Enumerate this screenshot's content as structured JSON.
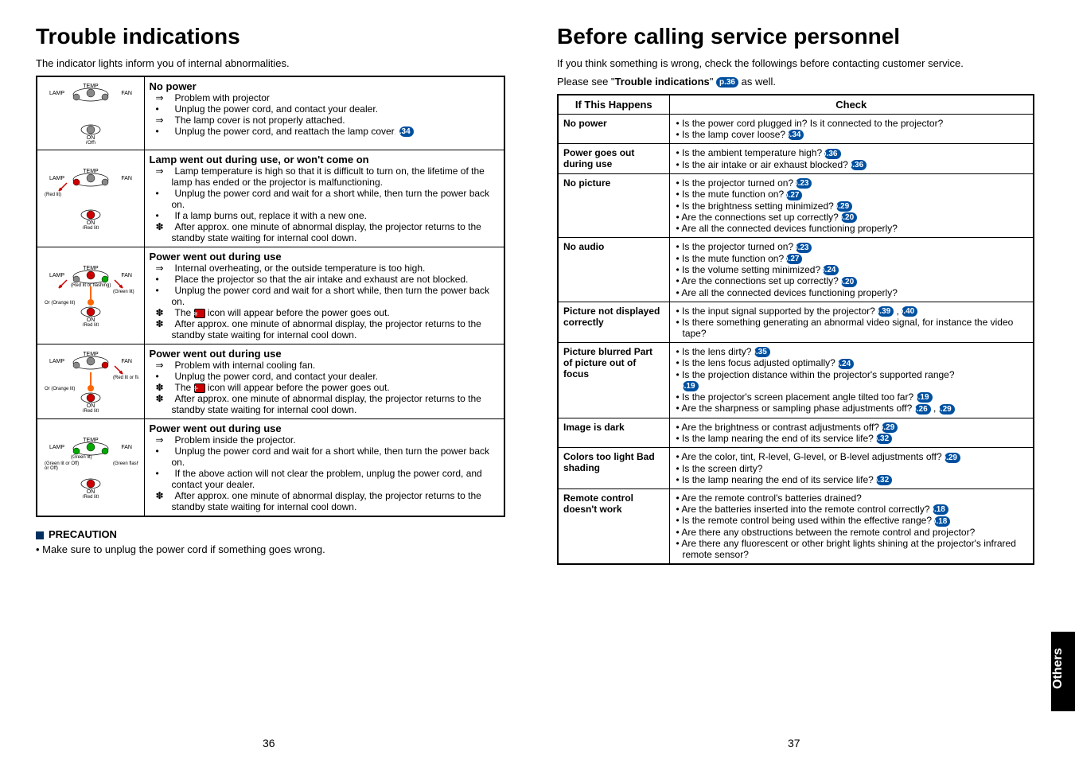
{
  "left": {
    "heading": "Trouble indications",
    "intro": "The indicator lights inform you of internal abnormalities.",
    "rows": [
      {
        "svg_labels": {
          "temp": "TEMP",
          "lamp": "LAMP",
          "fan": "FAN",
          "on": "ON",
          "sub": "(Off)"
        },
        "svg_colors": {
          "temp": "#888",
          "lamp": "#888",
          "fan": "#888",
          "on": "#888",
          "arrows": false
        },
        "title": "No power",
        "lines": [
          {
            "prefix": "⇒",
            "text": "Problem with projector"
          },
          {
            "prefix": "•",
            "text": "Unplug the power cord, and contact your dealer."
          },
          {
            "prefix": "⇒",
            "text": "The lamp cover is not properly attached."
          },
          {
            "prefix": "•",
            "text": "Unplug the power cord, and reattach the lamp cover.",
            "pref": "p.34"
          }
        ]
      },
      {
        "svg_labels": {
          "temp": "TEMP",
          "lamp": "LAMP",
          "fan": "FAN",
          "on": "ON",
          "sub": "(Red lit)",
          "lampnote": "(Red lit)"
        },
        "svg_colors": {
          "lamp": "#c00",
          "on": "#c00",
          "arrows": "lamp"
        },
        "title": "Lamp went out during use, or won't come on",
        "lines": [
          {
            "prefix": "⇒",
            "text": "Lamp temperature is high so that it is difficult to turn on, the lifetime of the lamp has ended or the projector is malfunctioning."
          },
          {
            "prefix": "•",
            "text": "Unplug the power cord and wait for a short while, then turn the power back on."
          },
          {
            "prefix": "•",
            "text": "If a lamp burns out, replace it with a new one."
          },
          {
            "prefix": "✽",
            "text": "After approx. one minute of abnormal display, the projector returns to the standby state waiting for internal cool down."
          }
        ]
      },
      {
        "svg_labels": {
          "temp": "TEMP",
          "lamp": "LAMP",
          "fan": "FAN",
          "on": "ON",
          "sub": "(Red lit)",
          "tempnote": "(Red lit or flashing)",
          "fannote": "(Green lit)",
          "midnote": "Or (Orange lit)"
        },
        "svg_colors": {
          "temp": "#c00",
          "fan": "#0a0",
          "on": "#c00",
          "mid": "#f60",
          "arrows": "both"
        },
        "title": "Power went out during use",
        "lines": [
          {
            "prefix": "⇒",
            "text": "Internal overheating, or the outside temperature is too high."
          },
          {
            "prefix": "•",
            "text": "Place the projector so that the air intake and exhaust are not blocked."
          },
          {
            "prefix": "•",
            "text": "Unplug the power cord and wait for a short while, then turn the power back on."
          },
          {
            "prefix": "✽",
            "text": "The ",
            "icon": "heat",
            "text2": " icon will appear before the power goes out."
          },
          {
            "prefix": "✽",
            "text": "After approx. one minute of abnormal display, the projector returns to the standby state waiting for internal cool down."
          }
        ]
      },
      {
        "svg_labels": {
          "temp": "TEMP",
          "lamp": "LAMP",
          "fan": "FAN",
          "on": "ON",
          "sub": "(Red lit)",
          "fannote": "(Red lit or flashing)",
          "midnote": "Or (Orange lit)"
        },
        "svg_colors": {
          "fan": "#c00",
          "on": "#c00",
          "mid": "#f60",
          "arrows": "fan"
        },
        "title": "Power went out during use",
        "lines": [
          {
            "prefix": "⇒",
            "text": "Problem with internal cooling fan."
          },
          {
            "prefix": "•",
            "text": "Unplug the power cord, and contact your dealer."
          },
          {
            "prefix": "✽",
            "text": "The ",
            "icon": "fan",
            "text2": " icon will appear before the power goes out."
          },
          {
            "prefix": "✽",
            "text": "After approx. one minute of abnormal display, the projector returns to the standby state waiting for internal cool down."
          }
        ]
      },
      {
        "svg_labels": {
          "temp": "TEMP",
          "lamp": "LAMP",
          "fan": "FAN",
          "on": "ON",
          "sub": "(Red lit)",
          "tempnote": "(Green lit)",
          "lampnote": "(Green lit or Off)",
          "lampnote2": "or Off)",
          "fannote": "(Green flashing)"
        },
        "svg_colors": {
          "temp": "#0a0",
          "lamp": "#0a0",
          "fan": "#0a0",
          "on": "#c00"
        },
        "title": "Power went out during use",
        "lines": [
          {
            "prefix": "⇒",
            "text": "Problem inside the projector."
          },
          {
            "prefix": "•",
            "text": "Unplug the power cord and wait for a short while, then turn the power back on."
          },
          {
            "prefix": "•",
            "text": "If the above action will not clear the problem, unplug  the power cord, and contact your dealer."
          },
          {
            "prefix": "✽",
            "text": "After approx. one minute of abnormal display, the projector returns to the standby state waiting for internal cool down."
          }
        ]
      }
    ],
    "precaution_head": "PRECAUTION",
    "precaution_text": "• Make sure to unplug the power cord if something goes wrong.",
    "pagenum": "36"
  },
  "right": {
    "heading": "Before calling service personnel",
    "intro1": "If you think something is wrong, check the followings before contacting customer service.",
    "intro2a": "Please see \"",
    "intro2b": "Trouble indications",
    "intro2c": "\" ",
    "intro2_pref": "p.36",
    "intro2d": " as well.",
    "head_col1": "If This Happens",
    "head_col2": "Check",
    "rows": [
      {
        "happens": "No power",
        "checks": [
          {
            "t": "Is the power cord plugged in? Is it connected to the projector?"
          },
          {
            "t": "Is the lamp cover loose?",
            "p": [
              "p.34"
            ]
          }
        ]
      },
      {
        "happens": "Power goes out during use",
        "checks": [
          {
            "t": "Is the ambient temperature high?",
            "p": [
              "p.36"
            ]
          },
          {
            "t": "Is the air intake or air exhaust blocked?",
            "p": [
              "p.36"
            ]
          }
        ]
      },
      {
        "happens": "No picture",
        "checks": [
          {
            "t": "Is the projector turned on?",
            "p": [
              "p.23"
            ]
          },
          {
            "t": "Is the mute function on?",
            "p": [
              "p.27"
            ]
          },
          {
            "t": "Is the brightness setting minimized?",
            "p": [
              "p.29"
            ]
          },
          {
            "t": "Are the connections set up correctly?",
            "p": [
              "p.20"
            ]
          },
          {
            "t": "Are all the connected devices functioning properly?"
          }
        ]
      },
      {
        "happens": "No audio",
        "checks": [
          {
            "t": "Is the projector turned on?",
            "p": [
              "p.23"
            ]
          },
          {
            "t": "Is the mute function on?",
            "p": [
              "p.27"
            ]
          },
          {
            "t": "Is the volume setting minimized?",
            "p": [
              "p.24"
            ]
          },
          {
            "t": "Are the connections set up correctly?",
            "p": [
              "p.20"
            ]
          },
          {
            "t": "Are all the connected devices functioning properly?"
          }
        ]
      },
      {
        "happens": "Picture not displayed correctly",
        "checks": [
          {
            "t": "Is the input signal supported by the projector?",
            "p": [
              "p.39",
              "p.40"
            ]
          },
          {
            "t": "Is there something generating an abnormal video signal, for instance the video tape?"
          }
        ]
      },
      {
        "happens": "Picture blurred Part of picture out of focus",
        "checks": [
          {
            "t": "Is the lens dirty?",
            "p": [
              "p.35"
            ]
          },
          {
            "t": "Is the lens focus adjusted optimally?",
            "p": [
              "p.24"
            ]
          },
          {
            "t": "Is the projection distance within the projector's supported range?",
            "p": [
              "p.19"
            ],
            "break": true
          },
          {
            "t": "Is the projector's screen placement angle tilted too far? ",
            "p": [
              "p.19"
            ]
          },
          {
            "t": "Are the sharpness or sampling phase adjustments off?",
            "p": [
              "p.26",
              "p.29"
            ]
          }
        ]
      },
      {
        "happens": "Image is dark",
        "checks": [
          {
            "t": "Are the brightness or contrast adjustments off?",
            "p": [
              "p.29"
            ]
          },
          {
            "t": "Is the lamp nearing the end of its service life?",
            "p": [
              "p.32"
            ]
          }
        ]
      },
      {
        "happens": "Colors too light Bad shading",
        "checks": [
          {
            "t": "Are the color, tint, R-level, G-level, or B-level adjustments off?",
            "p": [
              "p.29"
            ]
          },
          {
            "t": "Is the screen dirty?"
          },
          {
            "t": "Is the lamp nearing the end of its service life?",
            "p": [
              "p.32"
            ]
          }
        ]
      },
      {
        "happens": "Remote control doesn't work",
        "checks": [
          {
            "t": "Are the remote control's batteries drained?"
          },
          {
            "t": "Are the batteries inserted into the remote control correctly?",
            "p": [
              "p.18"
            ]
          },
          {
            "t": "Is the remote control being used within the effective range?",
            "p": [
              "p.18"
            ]
          },
          {
            "t": "Are there any obstructions between the remote control and projector?"
          },
          {
            "t": "Are there any fluorescent or other bright lights shining at the projector's infrared remote sensor?"
          }
        ]
      }
    ],
    "pagenum": "37",
    "sidetab": "Others"
  }
}
